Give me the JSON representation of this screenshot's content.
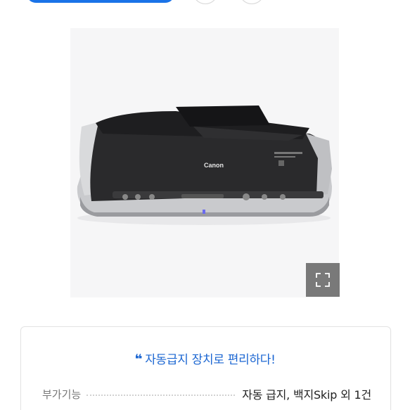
{
  "product": {
    "brand_mark": "Canon",
    "expand_icon": "expand-icon"
  },
  "card": {
    "quote_icon": "❝",
    "headline": "자동급지 장치로 편리하다!",
    "spec_label": "부가기능",
    "spec_value": "자동 급지, 백지Skip 외 1건"
  },
  "colors": {
    "accent": "#1b66d2",
    "top_button": "#1a73e8"
  }
}
